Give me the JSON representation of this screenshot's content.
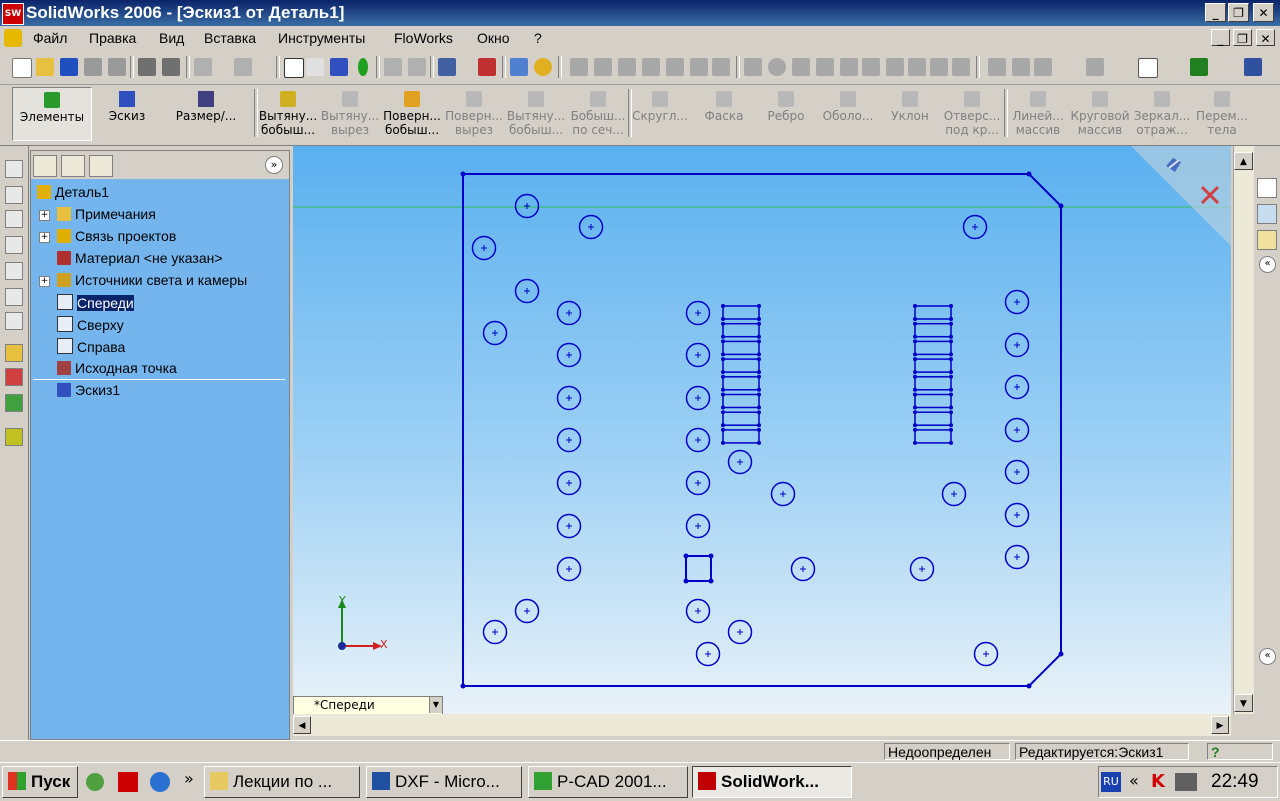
{
  "app": {
    "title": "SolidWorks 2006 - [Эскиз1 от Деталь1]",
    "logo_text": "SW",
    "window_buttons": [
      "_",
      "❐",
      "✕"
    ],
    "child_buttons": [
      "_",
      "❐",
      "✕"
    ]
  },
  "menu": {
    "items": [
      "Файл",
      "Правка",
      "Вид",
      "Вставка",
      "Инструменты",
      "FloWorks",
      "Окно",
      "?"
    ]
  },
  "command_manager": {
    "left": [
      {
        "label": "Элементы"
      },
      {
        "label": "Эскиз"
      },
      {
        "label": "Размер/..."
      }
    ],
    "features": [
      {
        "line1": "Вытяну...",
        "line2": "бобыш...",
        "enabled": true
      },
      {
        "line1": "Вытяну...",
        "line2": "вырез",
        "enabled": false
      },
      {
        "line1": "Поверн...",
        "line2": "бобыш...",
        "enabled": true
      },
      {
        "line1": "Поверн...",
        "line2": "вырез",
        "enabled": false
      },
      {
        "line1": "Вытяну...",
        "line2": "бобыш...",
        "enabled": false
      },
      {
        "line1": "Бобыш...",
        "line2": "по сеч...",
        "enabled": false
      },
      {
        "line1": "Скругл...",
        "line2": "",
        "enabled": false
      },
      {
        "line1": "Фаска",
        "line2": "",
        "enabled": false
      },
      {
        "line1": "Ребро",
        "line2": "",
        "enabled": false
      },
      {
        "line1": "Оболо...",
        "line2": "",
        "enabled": false
      },
      {
        "line1": "Уклон",
        "line2": "",
        "enabled": false
      },
      {
        "line1": "Отверс...",
        "line2": "под кр...",
        "enabled": false
      },
      {
        "line1": "Линей...",
        "line2": "массив",
        "enabled": false
      },
      {
        "line1": "Круговой",
        "line2": "массив",
        "enabled": false
      },
      {
        "line1": "Зеркал...",
        "line2": "отраж...",
        "enabled": false
      },
      {
        "line1": "Перем...",
        "line2": "тела",
        "enabled": false
      }
    ]
  },
  "feature_tree": {
    "root": "Деталь1",
    "items": [
      {
        "label": "Примечания",
        "expandable": true,
        "icon": "annotation-icon"
      },
      {
        "label": "Связь проектов",
        "expandable": true,
        "icon": "design-binder-icon"
      },
      {
        "label": "Материал <не указан>",
        "expandable": false,
        "icon": "material-icon"
      },
      {
        "label": "Источники света и камеры",
        "expandable": true,
        "icon": "lights-cameras-icon"
      },
      {
        "label": "Спереди",
        "expandable": false,
        "icon": "plane-icon",
        "selected": true
      },
      {
        "label": "Сверху",
        "expandable": false,
        "icon": "plane-icon"
      },
      {
        "label": "Справа",
        "expandable": false,
        "icon": "plane-icon"
      },
      {
        "label": "Исходная точка",
        "expandable": false,
        "icon": "origin-icon"
      },
      {
        "label": "Эскиз1",
        "expandable": false,
        "icon": "sketch-icon"
      }
    ],
    "collapse_label": "»"
  },
  "graphics": {
    "view_name": "*Спереди",
    "triad": {
      "x": "X",
      "y": "Y"
    },
    "sketch_color": "#0000c8",
    "confirm_icon": "sketch-exit-icon",
    "cancel_icon": "cancel-x-icon"
  },
  "status": {
    "definition": "Недоопределен",
    "editing": "Редактируется:Эскиз1",
    "help": "?"
  },
  "taskbar": {
    "start": "Пуск",
    "tasks": [
      {
        "label": "Лекции по ...",
        "icon": "folder-icon"
      },
      {
        "label": "DXF - Micro...",
        "icon": "word-icon"
      },
      {
        "label": "P-CAD 2001...",
        "icon": "pcad-icon"
      },
      {
        "label": "SolidWork...",
        "icon": "solidworks-icon",
        "active": true
      }
    ],
    "lang": "RU",
    "time": "22:49",
    "overflow": "»",
    "tray_overflow": "«"
  }
}
